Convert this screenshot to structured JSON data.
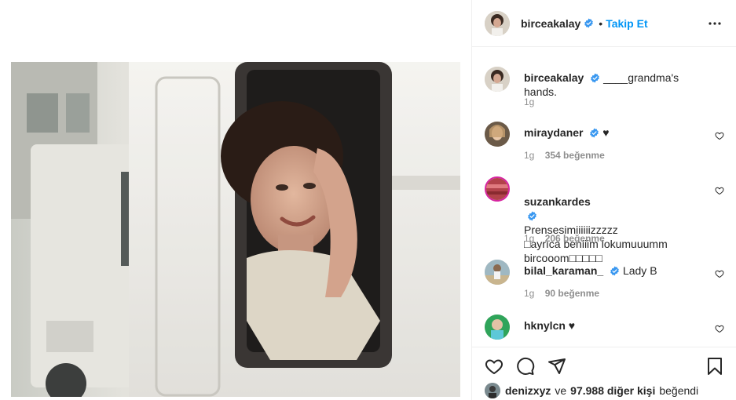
{
  "post": {
    "author": "birceakalay",
    "follow_dot": "•",
    "follow_label": "Takip Et",
    "more_icon": "more-horizontal-icon"
  },
  "comments": [
    {
      "username": "birceakalay",
      "verified": true,
      "text": "____grandma's hands.",
      "time": "1g",
      "likes": ""
    },
    {
      "username": "miraydaner",
      "verified": true,
      "text": "♥",
      "time": "1g",
      "likes": "354 beğenme"
    },
    {
      "username": "suzankardes",
      "verified": true,
      "text": "Prensesimiiiiiizzzzz\n□ayrıca beniiim lokumuuumm\nbircooom□□□□□",
      "time": "1g",
      "likes": "206 beğenme"
    },
    {
      "username": "bilal_karaman_",
      "verified": true,
      "text": "Lady B",
      "time": "1g",
      "likes": "90 beğenme"
    },
    {
      "username": "hknylcn",
      "verified": false,
      "text": "♥",
      "time": "",
      "likes": ""
    }
  ],
  "liked_by": {
    "first": "denizxyz",
    "connector": "ve",
    "others": "97.988 diğer kişi",
    "suffix": "beğendi"
  },
  "colors": {
    "accent": "#0095f6",
    "text": "#262626",
    "muted": "#8e8e8e",
    "border": "#efefef"
  }
}
